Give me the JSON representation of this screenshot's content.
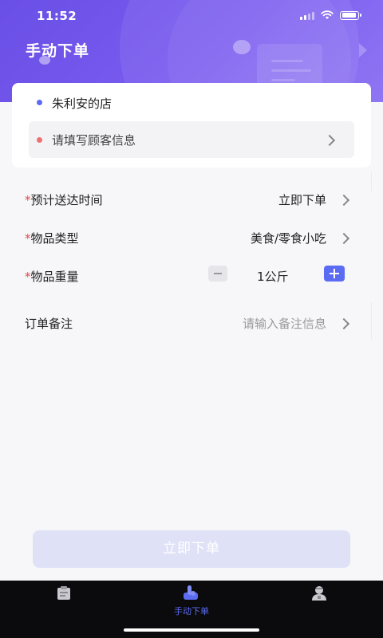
{
  "status_bar": {
    "time": "11:52"
  },
  "header": {
    "title": "手动下单"
  },
  "shop": {
    "name": "朱利安的店"
  },
  "customer": {
    "placeholder": "请填写顾客信息"
  },
  "form": {
    "required_mark": "*",
    "delivery_time": {
      "label": "预计送达时间",
      "value": "立即下单"
    },
    "item_type": {
      "label": "物品类型",
      "value": "美食/零食小吃"
    },
    "item_weight": {
      "label": "物品重量",
      "value": "1公斤"
    },
    "remark": {
      "label": "订单备注",
      "placeholder": "请输入备注信息"
    }
  },
  "submit": {
    "label": "立即下单"
  },
  "tabbar": {
    "active_label": "手动下单",
    "icons": [
      "orders-icon",
      "manual-order-icon",
      "profile-icon"
    ]
  },
  "colors": {
    "header": "#6a4fe6",
    "accent": "#5b6cf2",
    "shop_dot": "#5b6cf2",
    "customer_dot": "#f07070",
    "required": "#e04a4a",
    "submit_disabled": "#dfe2f7"
  }
}
